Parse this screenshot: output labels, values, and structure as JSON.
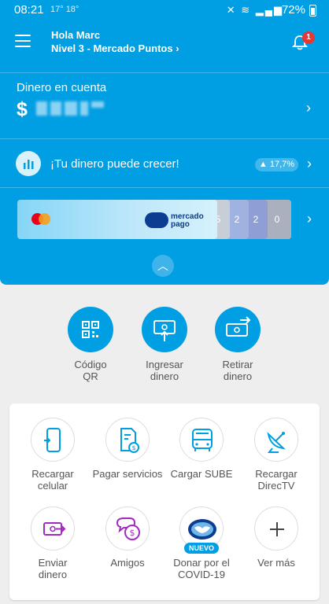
{
  "status_bar": {
    "time": "08:21",
    "temps": "17° 18°",
    "battery": "72%"
  },
  "header": {
    "greeting": "Hola Marc",
    "level": "Nivel 3 - Mercado Puntos",
    "notifications": "1"
  },
  "account": {
    "label": "Dinero en cuenta",
    "currency": "$"
  },
  "growth": {
    "text": "¡Tu dinero puede crecer!",
    "rate": "17,7%"
  },
  "cards": {
    "brand_line1": "mercado",
    "brand_line2": "pago",
    "stack": [
      "5",
      "2",
      "2",
      "0"
    ]
  },
  "quick_actions": [
    {
      "label": "Código QR",
      "icon": "qr-code-icon"
    },
    {
      "label": "Ingresar dinero",
      "icon": "deposit-money-icon"
    },
    {
      "label": "Retirar dinero",
      "icon": "withdraw-money-icon"
    }
  ],
  "services": [
    {
      "label": "Recargar celular",
      "icon": "phone-icon"
    },
    {
      "label": "Pagar servicios",
      "icon": "bill-icon"
    },
    {
      "label": "Cargar SUBE",
      "icon": "bus-icon"
    },
    {
      "label": "Recargar DirecTV",
      "icon": "satellite-dish-icon"
    },
    {
      "label": "Enviar dinero",
      "icon": "send-money-icon"
    },
    {
      "label": "Amigos",
      "icon": "friends-money-icon"
    },
    {
      "label": "Donar por el COVID-19",
      "icon": "covid-donation-icon",
      "badge": "NUEVO"
    },
    {
      "label": "Ver más",
      "icon": "plus-icon"
    }
  ],
  "colors": {
    "brand_blue": "#009ee3",
    "purple": "#a32ac0",
    "notification_red": "#e53935"
  }
}
